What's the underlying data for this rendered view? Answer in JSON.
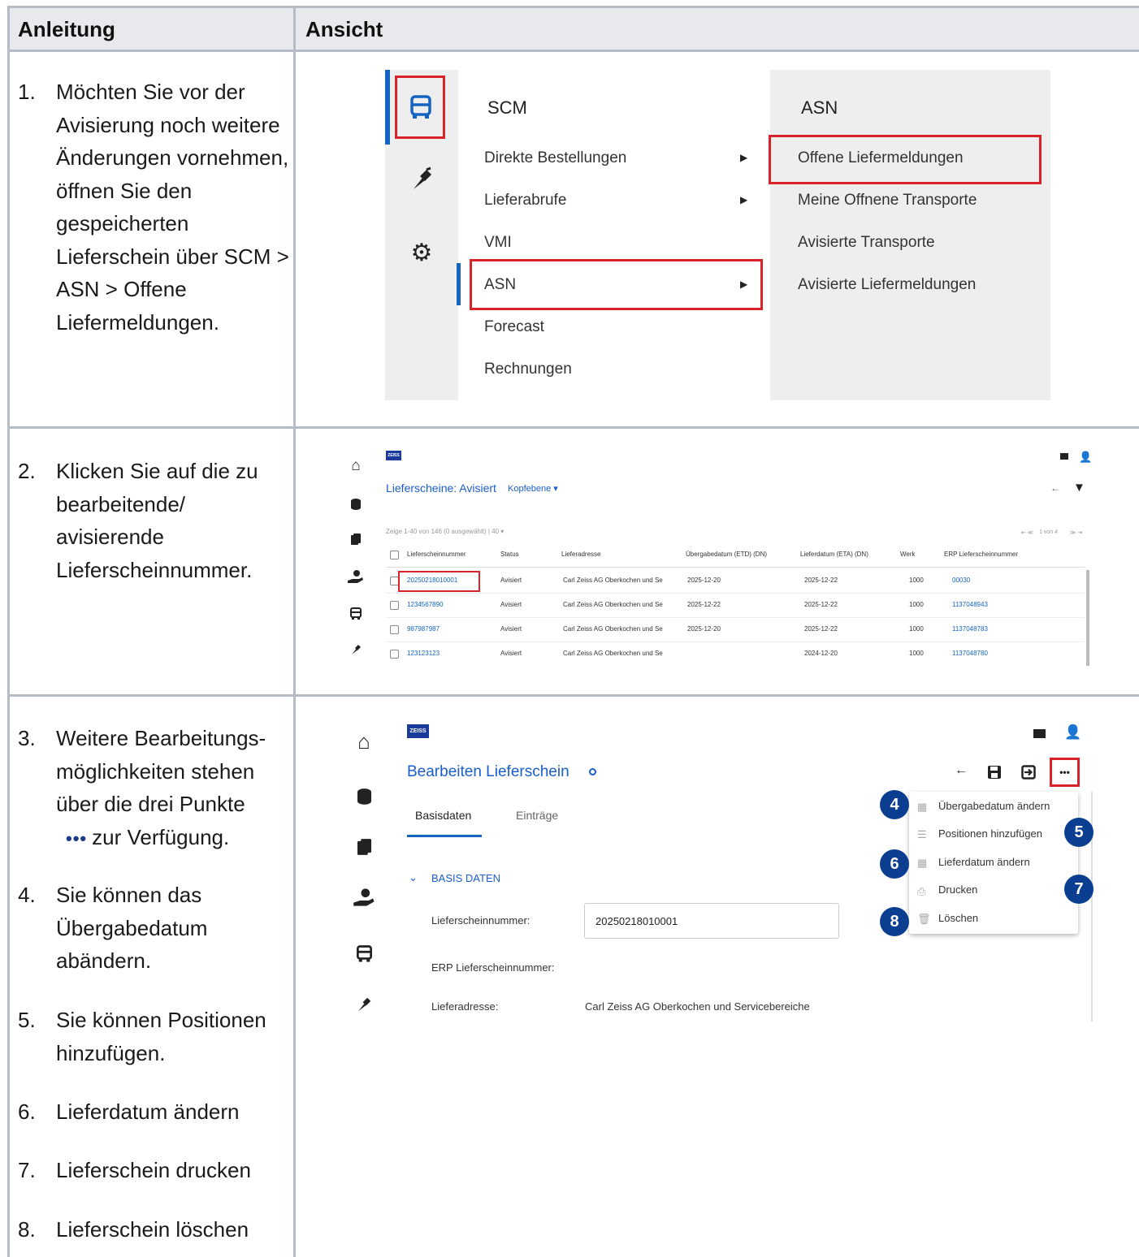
{
  "header": {
    "col1": "Anleitung",
    "col2": "Ansicht"
  },
  "instructions": {
    "step1": {
      "num": "1.",
      "text": "Möchten Sie vor der Avisierung noch weitere Änderungen vornehmen, öffnen Sie den gespeicherten Lieferschein über SCM > ASN > Offene Liefermeldungen."
    },
    "step2": {
      "num": "2.",
      "text": "Klicken Sie auf die zu bearbeitende/ avisierende Lieferscheinnummer."
    },
    "step3": {
      "num": "3.",
      "text_before": "Weitere Bearbeitungs-möglichkeiten stehen über die drei Punkte",
      "dots": "•••",
      "text_after": "zur Verfügung."
    },
    "step4": {
      "num": "4.",
      "text": "Sie können das Übergabedatum abändern."
    },
    "step5": {
      "num": "5.",
      "text": "Sie können Positionen hinzufügen."
    },
    "step6": {
      "num": "6.",
      "text": "Lieferdatum ändern"
    },
    "step7": {
      "num": "7.",
      "text": "Lieferschein drucken"
    },
    "step8": {
      "num": "8.",
      "text": "Lieferschein löschen"
    }
  },
  "menu_screenshot": {
    "col1_title": "SCM",
    "items": [
      "Direkte Bestellungen",
      "Lieferabrufe",
      "VMI",
      "ASN",
      "Forecast",
      "Rechnungen"
    ],
    "col2_title": "ASN",
    "sub_items": [
      "Offene Liefermeldungen",
      "Meine Offnene Transporte",
      "Avisierte Transporte",
      "Avisierte Liefermeldungen"
    ],
    "icons": [
      "truck-icon",
      "tools-icon",
      "gear-icon"
    ],
    "highlight_color": "#d8232a"
  },
  "list_screenshot": {
    "logo": "ZEISS",
    "title": "Lieferscheine: Avisiert",
    "view_select": "Kopfebene ▾",
    "paging_info": "Zeige 1-40 von 146 (0 ausgewählt) | 40 ▾",
    "pager": "1 von 4",
    "columns": [
      "Lieferscheinnummer",
      "Status",
      "Lieferadresse",
      "Übergabedatum (ETD) (DN)",
      "Lieferdatum (ETA) (DN)",
      "Werk",
      "ERP Lieferscheinnummer"
    ],
    "rows": [
      [
        "20250218010001",
        "Avisiert",
        "Carl Zeiss AG Oberkochen und Se",
        "2025-12-20",
        "2025-12-22",
        "1000",
        "00030"
      ],
      [
        "1234567890",
        "Avisiert",
        "Carl Zeiss AG Oberkochen und Se",
        "2025-12-22",
        "2025-12-22",
        "1000",
        "1137048943"
      ],
      [
        "987987987",
        "Avisiert",
        "Carl Zeiss AG Oberkochen und Se",
        "2025-12-20",
        "2025-12-22",
        "1000",
        "1137048783"
      ],
      [
        "123123123",
        "Avisiert",
        "Carl Zeiss AG Oberkochen und Se",
        "",
        "2024-12-20",
        "1000",
        "1137048780"
      ]
    ]
  },
  "edit_screenshot": {
    "logo": "ZEISS",
    "title": "Bearbeiten Lieferschein",
    "tabs": [
      "Basisdaten",
      "Einträge"
    ],
    "section": "BASIS DATEN",
    "fields": [
      {
        "label": "Lieferscheinnummer:",
        "value": "20250218010001"
      },
      {
        "label": "ERP Lieferscheinnummer:",
        "value": ""
      },
      {
        "label": "Lieferadresse:",
        "value": "Carl Zeiss AG Oberkochen und Servicebereiche"
      }
    ],
    "more_menu": [
      "Übergabedatum ändern",
      "Positionen hinzufügen",
      "Lieferdatum ändern",
      "Drucken",
      "Löschen"
    ],
    "badges": [
      "4",
      "5",
      "6",
      "7",
      "8"
    ],
    "more_button": "•••",
    "back_arrow": "←"
  }
}
